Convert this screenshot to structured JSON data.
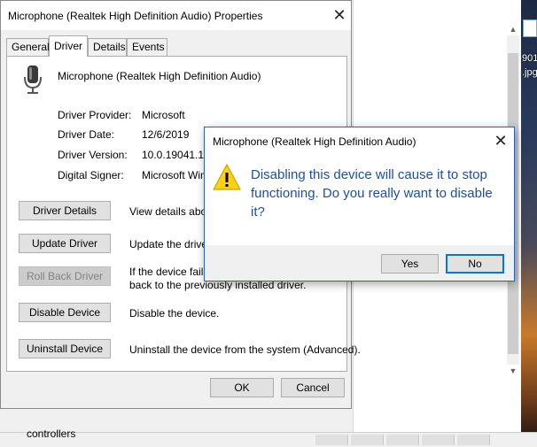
{
  "background": {
    "desktop_labels": [
      "901",
      ".jpg"
    ],
    "bottom_text": "controllers"
  },
  "properties": {
    "title": "Microphone (Realtek High Definition Audio) Properties",
    "tabs": [
      "General",
      "Driver",
      "Details",
      "Events"
    ],
    "active_tab": "Driver",
    "device_name": "Microphone (Realtek High Definition Audio)",
    "info": [
      {
        "label": "Driver Provider:",
        "value": "Microsoft"
      },
      {
        "label": "Driver Date:",
        "value": "12/6/2019"
      },
      {
        "label": "Driver Version:",
        "value": "10.0.19041.1"
      },
      {
        "label": "Digital Signer:",
        "value": "Microsoft Wind"
      }
    ],
    "actions": [
      {
        "button": "Driver Details",
        "description": "View details about",
        "enabled": true
      },
      {
        "button": "Update Driver",
        "description": "Update the driver",
        "enabled": true
      },
      {
        "button": "Roll Back Driver",
        "description": "If the device fails",
        "description2": "back to the previously installed driver.",
        "enabled": false
      },
      {
        "button": "Disable Device",
        "description": "Disable the device.",
        "enabled": true
      },
      {
        "button": "Uninstall Device",
        "description": "Uninstall the device from the system (Advanced).",
        "enabled": true
      }
    ],
    "ok_label": "OK",
    "cancel_label": "Cancel"
  },
  "dialog": {
    "title": "Microphone (Realtek High Definition Audio)",
    "message": "Disabling this device will cause it to stop functioning. Do you really want to disable it?",
    "yes_label": "Yes",
    "no_label": "No",
    "icon": "warning-icon",
    "message_color": "#1f4e9c"
  }
}
